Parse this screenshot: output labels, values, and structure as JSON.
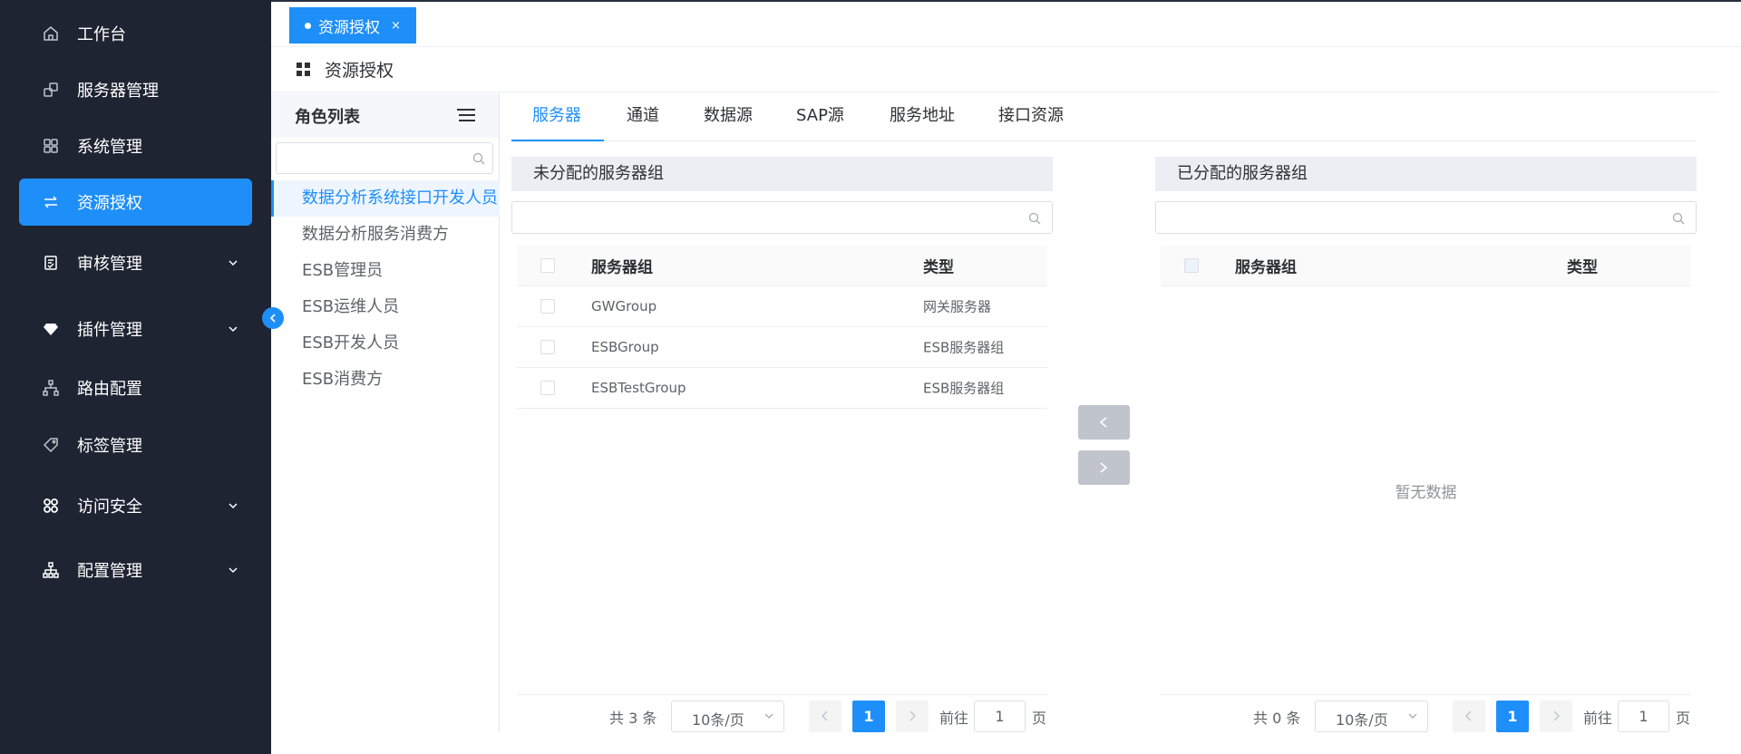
{
  "sidebar": {
    "items": [
      {
        "label": "工作台",
        "icon": "home-icon"
      },
      {
        "label": "服务器管理",
        "icon": "server-icon"
      },
      {
        "label": "系统管理",
        "icon": "grid-icon"
      },
      {
        "label": "资源授权",
        "icon": "swap-icon",
        "active": true
      },
      {
        "label": "审核管理",
        "icon": "audit-icon"
      },
      {
        "label": "插件管理",
        "icon": "diamond-icon"
      },
      {
        "label": "路由配置",
        "icon": "route-icon"
      },
      {
        "label": "标签管理",
        "icon": "tag-icon"
      },
      {
        "label": "访问安全",
        "icon": "security-icon"
      },
      {
        "label": "配置管理",
        "icon": "config-icon"
      }
    ]
  },
  "page_tab": {
    "label": "资源授权",
    "close": "×"
  },
  "breadcrumb": {
    "title": "资源授权"
  },
  "roles": {
    "title": "角色列表",
    "items": [
      "数据分析系统接口开发人员",
      "数据分析服务消费方",
      "ESB管理员",
      "ESB运维人员",
      "ESB开发人员",
      "ESB消费方"
    ]
  },
  "tabs": [
    "服务器",
    "通道",
    "数据源",
    "SAP源",
    "服务地址",
    "接口资源"
  ],
  "left_panel": {
    "title": "未分配的服务器组",
    "columns": {
      "name": "服务器组",
      "type": "类型"
    },
    "rows": [
      {
        "name": "GWGroup",
        "type": "网关服务器"
      },
      {
        "name": "ESBGroup",
        "type": "ESB服务器组"
      },
      {
        "name": "ESBTestGroup",
        "type": "ESB服务器组"
      }
    ],
    "pager": {
      "total": "共 3 条",
      "size": "10条/页",
      "page": "1",
      "goto": "前往",
      "goto_value": "1",
      "page_unit": "页"
    }
  },
  "right_panel": {
    "title": "已分配的服务器组",
    "columns": {
      "name": "服务器组",
      "type": "类型"
    },
    "empty": "暂无数据",
    "pager": {
      "total": "共 0 条",
      "size": "10条/页",
      "page": "1",
      "goto": "前往",
      "goto_value": "1",
      "page_unit": "页"
    }
  },
  "colors": {
    "sidebar_bg": "#1f2433",
    "accent": "#1e8ff8",
    "button_disabled": "#c0c4cc"
  }
}
